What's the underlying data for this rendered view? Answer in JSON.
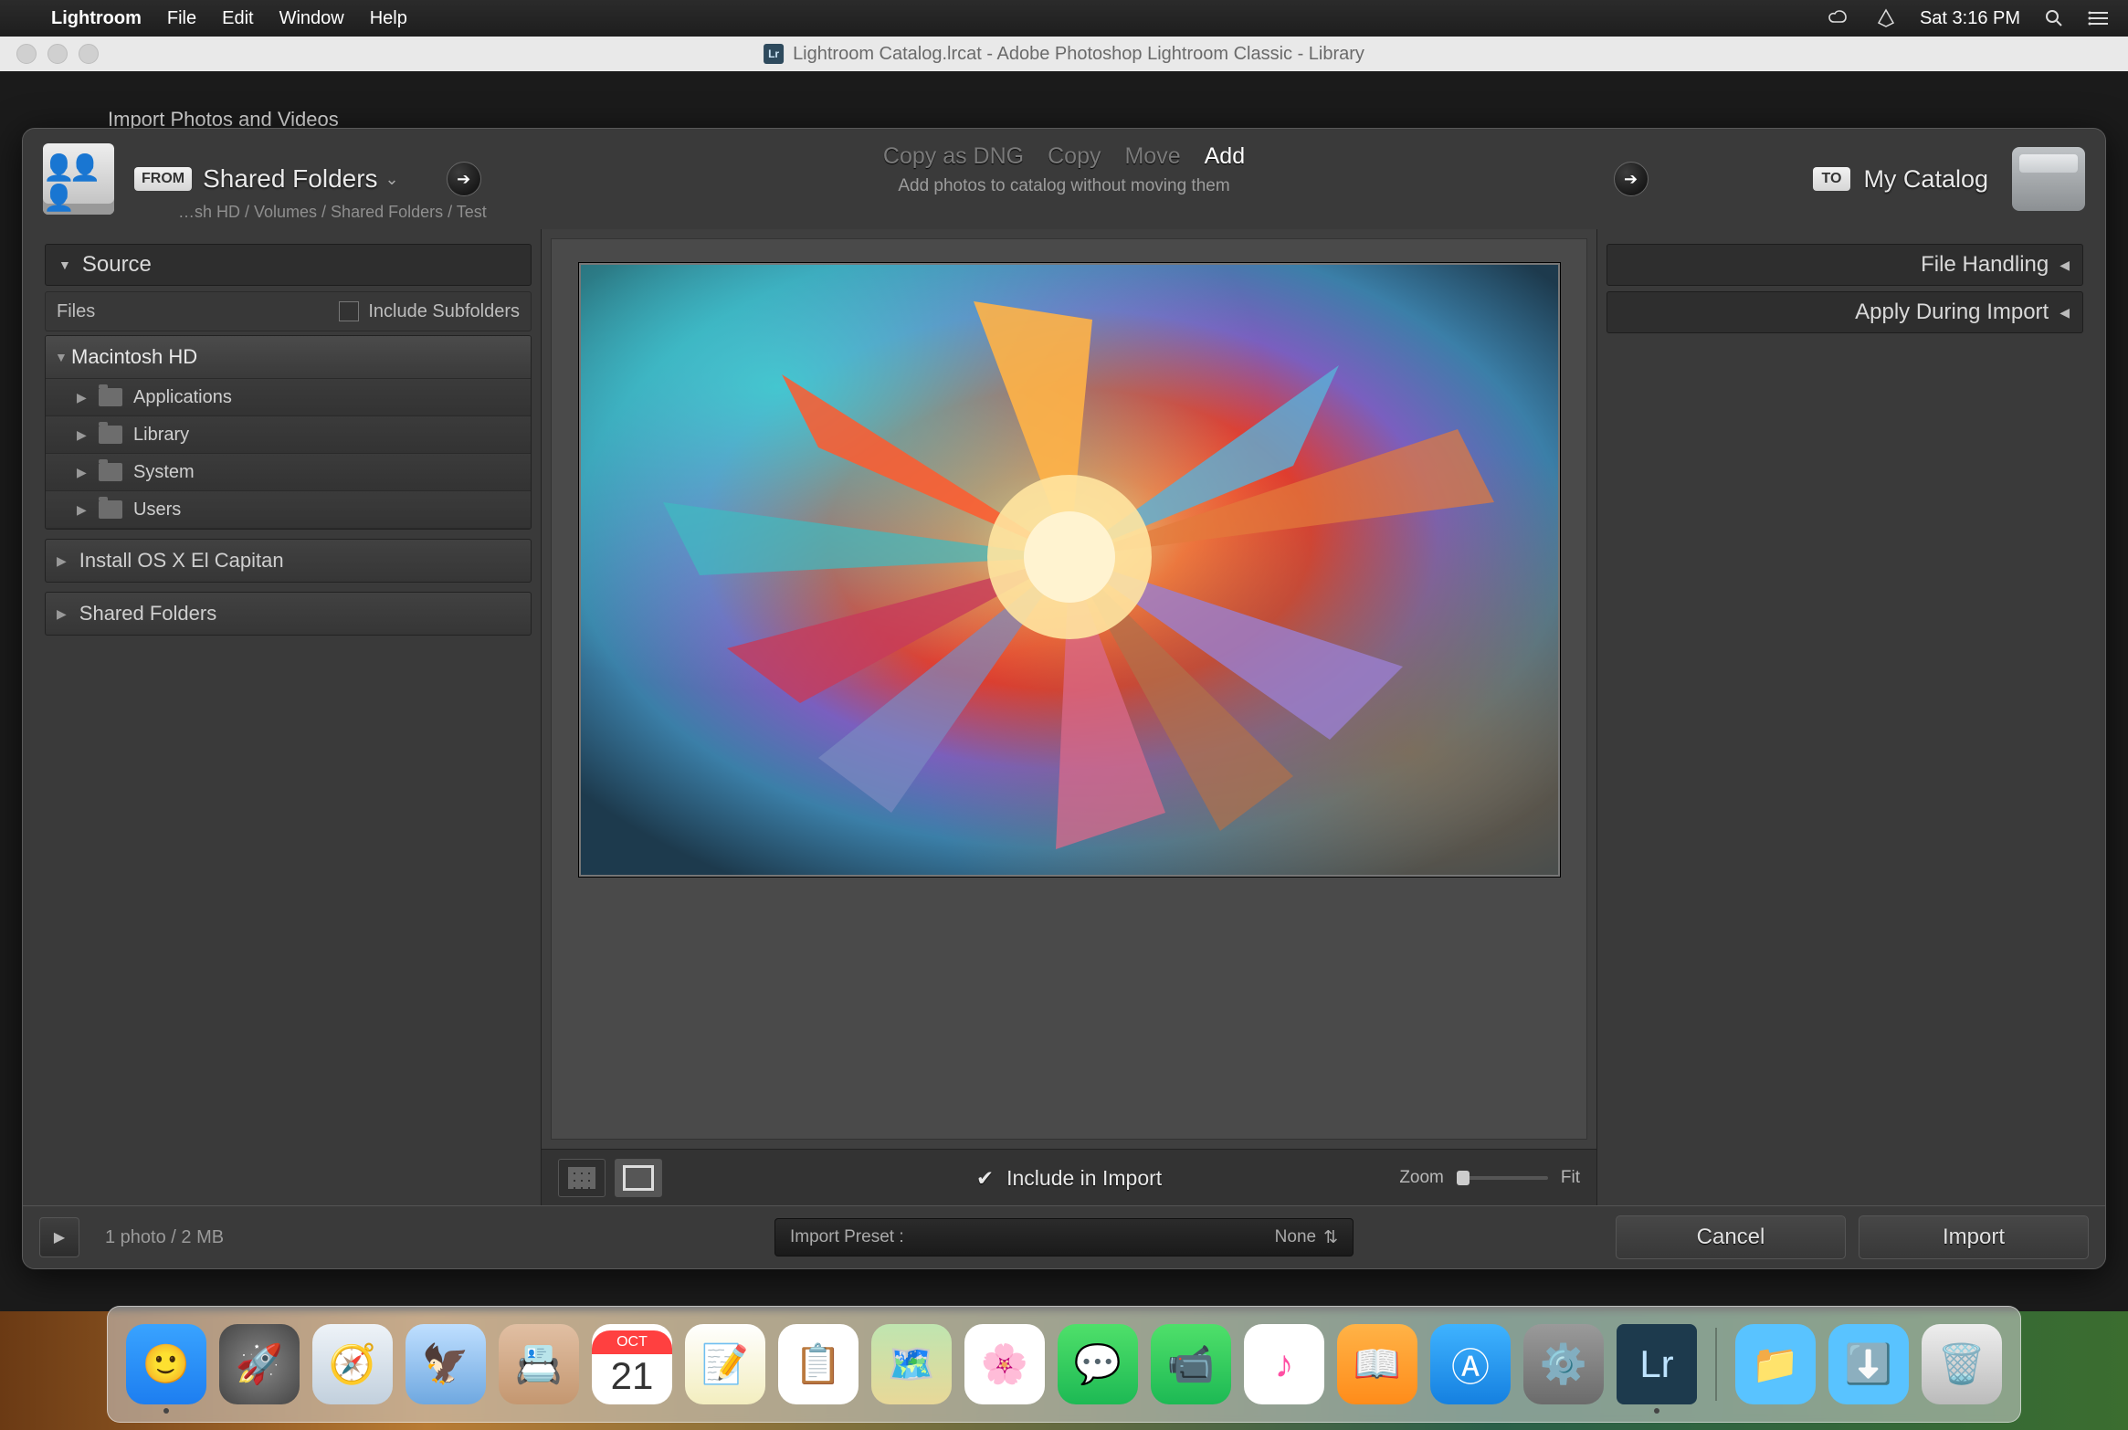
{
  "menubar": {
    "app": "Lightroom",
    "items": [
      "File",
      "Edit",
      "Window",
      "Help"
    ],
    "clock": "Sat 3:16 PM"
  },
  "window": {
    "title": "Lightroom Catalog.lrcat - Adobe Photoshop Lightroom Classic - Library"
  },
  "behind": "Import Photos and Videos",
  "import": {
    "from_label": "FROM",
    "source_name": "Shared Folders",
    "source_path": "…sh HD / Volumes / Shared Folders / Test",
    "modes": {
      "dng": "Copy as DNG",
      "copy": "Copy",
      "move": "Move",
      "add": "Add"
    },
    "mode_subtitle": "Add photos to catalog without moving them",
    "to_label": "TO",
    "dest_name": "My Catalog"
  },
  "left": {
    "source_header": "Source",
    "files_label": "Files",
    "include_subfolders": "Include Subfolders",
    "root": "Macintosh HD",
    "folders": [
      "Applications",
      "Library",
      "System",
      "Users"
    ],
    "drives": [
      "Install OS X El Capitan",
      "Shared Folders"
    ]
  },
  "right": {
    "file_handling": "File Handling",
    "apply_during": "Apply During Import"
  },
  "center": {
    "include": "Include in Import",
    "zoom": "Zoom",
    "fit": "Fit"
  },
  "bottom": {
    "status": "1 photo / 2 MB",
    "preset_label": "Import Preset :",
    "preset_value": "None",
    "cancel": "Cancel",
    "import": "Import"
  },
  "dock": {
    "cal_month": "OCT",
    "cal_day": "21",
    "lr": "Lr"
  }
}
